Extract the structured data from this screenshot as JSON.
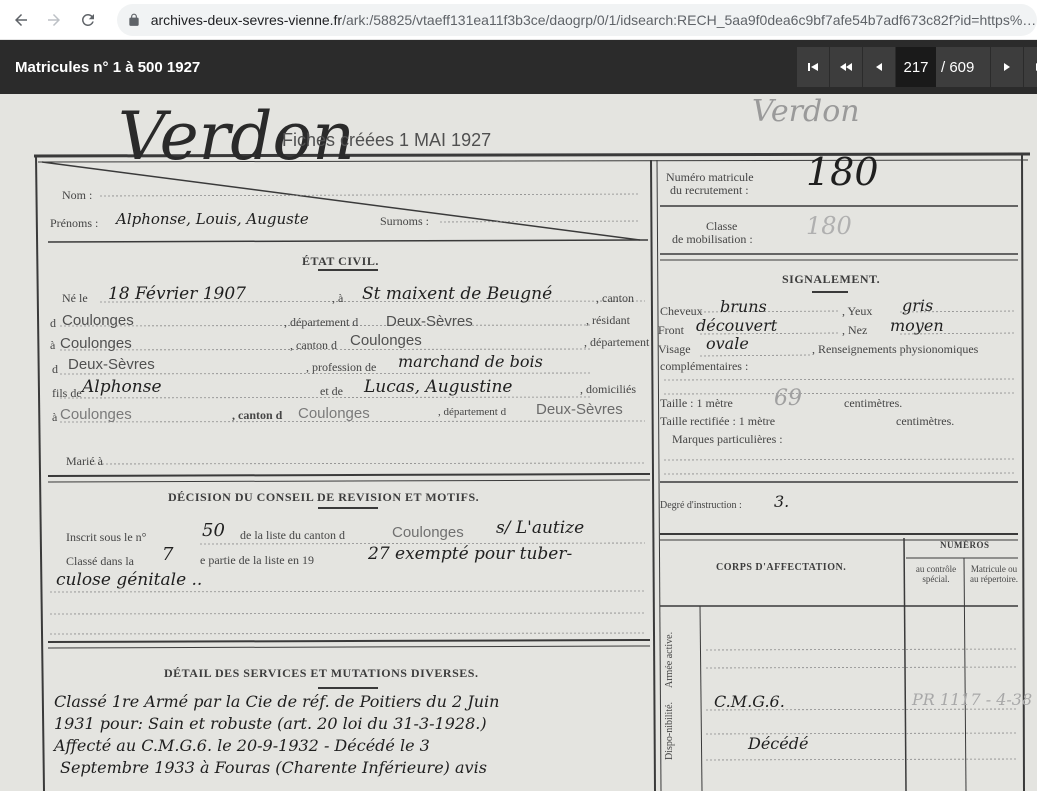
{
  "browser": {
    "url_host": "archives-deux-sevres-vienne.fr",
    "url_path": "/ark:/58825/vtaeff131ea11f3b3ce/daogrp/0/1/idsearch:RECH_5aa9f0dea6c9bf7afe54b7adf673c82f?id=https%3A..."
  },
  "viewer": {
    "title": "Matricules n° 1 à 500 1927",
    "current_page": "217",
    "total_pages": "/ 609"
  },
  "document": {
    "pencil_top": "Verdon",
    "handwritten_name": "Verdon",
    "stamp": "Fiches créées 1 MAI 1927",
    "nom_label": "Nom :",
    "prenoms_label": "Prénoms :",
    "prenoms_value": "Alphonse, Louis, Auguste",
    "surnoms_label": "Surnoms :",
    "matricule_label_1": "Numéro matricule",
    "matricule_label_2": "du recrutement :",
    "matricule_value": "180",
    "classe_label_1": "Classe",
    "classe_label_2": "de mobilisation :",
    "classe_value": "180",
    "etat_civil_heading": "ÉTAT CIVIL.",
    "ne_le_label": "Né le",
    "birth_date": "18 Février 1907",
    "a_label": ", à",
    "birth_place": "St maixent de Beugné",
    "canton_label": ", canton",
    "row2_prefix": "d",
    "row2_canton": "Coulonges",
    "row2_dept_label": ", département d",
    "row2_dept": "Deux-Sèvres",
    "row2_resident": ", résidant",
    "row3_prefix": "à",
    "row3_city": "Coulonges",
    "row3_canton_label": ", canton d",
    "row3_canton": "Coulonges",
    "row3_dept_label": ", département",
    "row4_prefix": "d",
    "row4_dept": "Deux-Sèvres",
    "profession_label": ", profession de",
    "profession_value": "marchand de bois",
    "fils_label": "fils de",
    "father": "Alphonse",
    "et_de_label": "et de",
    "mother": "Lucas, Augustine",
    "domicilies_label": ", domiciliés",
    "row6_prefix": "à",
    "row6_city": "Coulonges",
    "row6_canton_label": ", canton d",
    "row6_canton": "Coulonges",
    "row6_dept_label": ", département d",
    "row6_dept": "Deux-Sèvres",
    "marie_label": "Marié à",
    "signalement_heading": "SIGNALEMENT.",
    "cheveux_label": "Cheveux",
    "cheveux_value": "bruns",
    "yeux_label": ", Yeux",
    "yeux_value": "gris",
    "front_label": "Front",
    "front_value": "découvert",
    "nez_label": ", Nez",
    "nez_value": "moyen",
    "visage_label": "Visage",
    "visage_value": "ovale",
    "renseignements_label": ", Renseignements physionomiques",
    "complementaires_label": "complémentaires :",
    "taille_label": "Taille : 1 mètre",
    "taille_value": "69",
    "centimetres_label": "centimètres.",
    "taille_rectifiee_label": "Taille rectifiée : 1 mètre",
    "centimetres_label_2": "centimètres.",
    "marques_label": "Marques particulières :",
    "degre_label": "Degré d'instruction :",
    "degre_value": "3.",
    "decision_heading": "DÉCISION DU CONSEIL DE REVISION ET MOTIFS.",
    "inscrit_label": "Inscrit sous le n°",
    "inscrit_value": "50",
    "liste_canton_label": "de la liste du canton d",
    "liste_canton_value": "Coulonges",
    "liste_canton_hand": "s/ L'autize",
    "classe_dans_label": "Classé dans la",
    "partie_value": "7",
    "partie_label": "e partie de la liste en 19",
    "decision_hand_1": "27 exempté pour tuber-",
    "decision_hand_2": "culose génitale ..",
    "corps_heading": "CORPS D'AFFECTATION.",
    "numeros_heading": "NUMÉROS",
    "col_controle": "au contrôle spécial.",
    "col_matricule": "Matricule ou au répertoire.",
    "armee_active_label": "Armée active.",
    "disponibilite_label": "Dispo-nibilité.",
    "cmg_value": "C.M.G.6.",
    "decede_value": "Décédé",
    "pencil_ref": "PR 1117 - 4-38",
    "detail_heading": "DÉTAIL DES SERVICES ET MUTATIONS DIVERSES.",
    "detail_hand_1": "Classé 1re Armé par la Cie de réf. de Poitiers du 2 Juin",
    "detail_hand_2": "1931 pour: Sain et robuste (art. 20 loi du 31-3-1928.)",
    "detail_hand_3": "Affecté au C.M.G.6. le 20-9-1932 - Décédé le 3",
    "detail_hand_4": "Septembre 1933 à Fouras (Charente Inférieure) avis"
  }
}
